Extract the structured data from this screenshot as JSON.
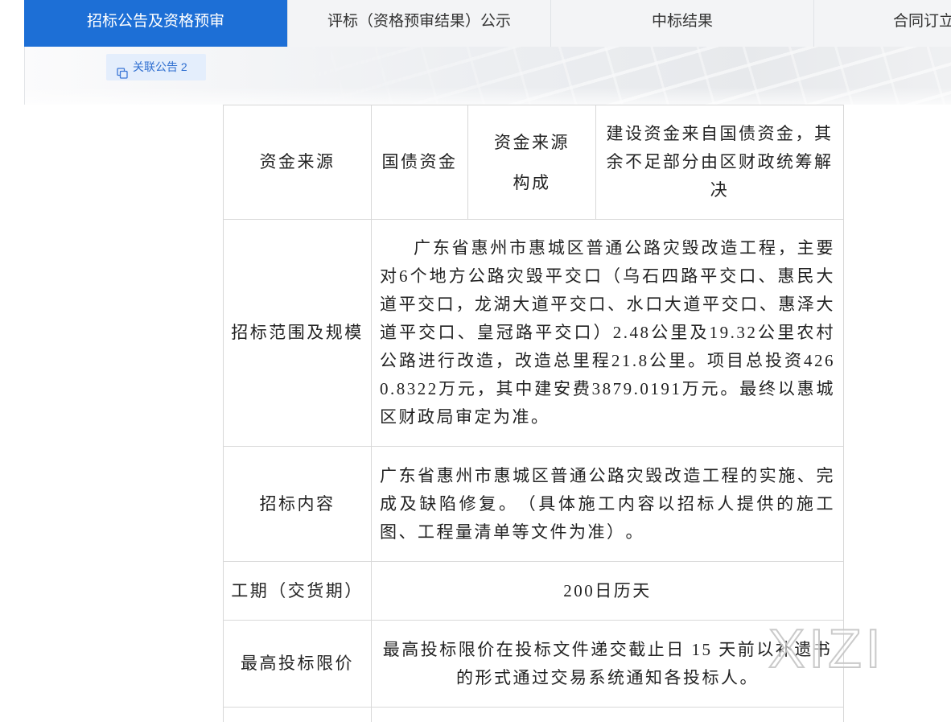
{
  "tabs": [
    {
      "label": "招标公告及资格预审",
      "active": true
    },
    {
      "label": "评标（资格预审结果）公示",
      "active": false
    },
    {
      "label": "中标结果",
      "active": false
    },
    {
      "label": "合同订立",
      "active": false
    }
  ],
  "banner": {
    "related_button": {
      "label": "关联公告 2",
      "icon": "copy-icon"
    }
  },
  "table": {
    "funding": {
      "label": "资金来源",
      "value": "国债资金",
      "composition_label": "资金来源构成",
      "composition_value": "建设资金来自国债资金，其余不足部分由区财政统筹解决"
    },
    "scope": {
      "label": "招标范围及规模",
      "content": "广东省惠州市惠城区普通公路灾毁改造工程，主要对6个地方公路灾毁平交口（乌石四路平交口、惠民大道平交口，龙湖大道平交口、水口大道平交口、惠泽大道平交口、皇冠路平交口）2.48公里及19.32公里农村公路进行改造，改造总里程21.8公里。项目总投资4260.8322万元，其中建安费3879.0191万元。最终以惠城区财政局审定为准。"
    },
    "bid_content": {
      "label": "招标内容",
      "content": "广东省惠州市惠城区普通公路灾毁改造工程的实施、完成及缺陷修复。（具体施工内容以招标人提供的施工图、工程量清单等文件为准）。"
    },
    "duration": {
      "label": "工期（交货期）",
      "value": "200日历天"
    },
    "max_bid_price": {
      "label": "最高投标限价",
      "content": "最高投标限价在投标文件递交截止日 15 天前以补遗书的形式通过交易系统通知各投标人。"
    }
  },
  "watermark": {
    "text": "XIZI"
  },
  "colors": {
    "accent": "#1d6fd6",
    "tab_bg": "#f3f4f6",
    "button_bg": "#e4eefc",
    "button_text": "#2f6fd0",
    "border": "#d8d8d8"
  }
}
